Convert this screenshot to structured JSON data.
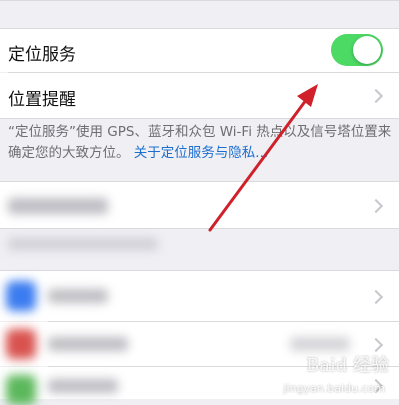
{
  "settings": {
    "location_services_label": "定位服务",
    "location_services_on": true,
    "location_alerts_label": "位置提醒",
    "footer_note": "“定位服务”使用 GPS、蓝牙和众包 Wi-Fi 热点以及信号塔位置来确定您的大致方位。",
    "footer_link": "关于定位服务与隐私..."
  },
  "watermark": {
    "text": "Baid 经验",
    "subtext": "jingyan.baidu.com"
  },
  "colors": {
    "toggle_on": "#4cd964",
    "link": "#1c6fd1",
    "arrow": "#d0202a"
  }
}
